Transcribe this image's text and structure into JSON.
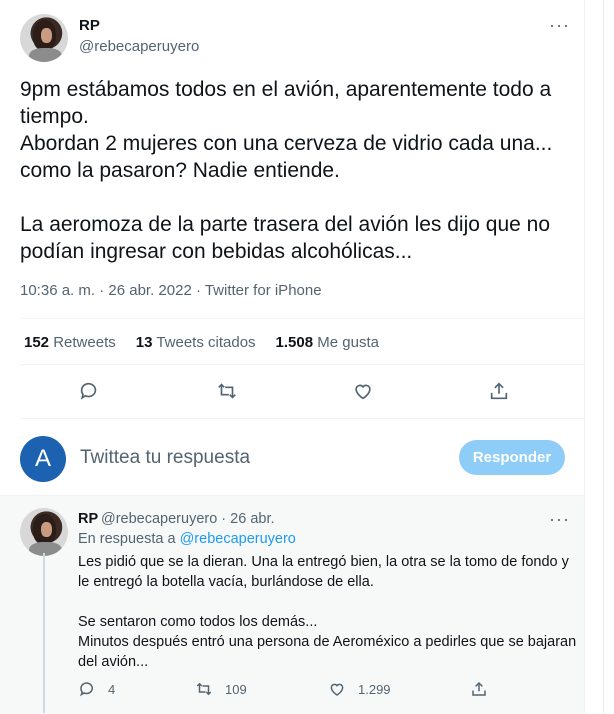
{
  "tweet": {
    "name": "RP",
    "handle": "@rebecaperuyero",
    "more": "···",
    "text": "9pm estábamos todos en el avión, aparentemente todo a tiempo.\nAbordan 2 mujeres con una cerveza de vidrio cada una... como la pasaron? Nadie entiende.\n\nLa aeromoza de la parte trasera del avión les dijo que no podían ingresar con bebidas alcohólicas...",
    "meta": "10:36 a. m. · 26 abr. 2022 · Twitter for iPhone",
    "stats": {
      "retweets_count": "152",
      "retweets_label": "Retweets",
      "quotes_count": "13",
      "quotes_label": "Tweets citados",
      "likes_count": "1.508",
      "likes_label": "Me gusta"
    },
    "actions": [
      "reply-icon",
      "retweet-icon",
      "like-icon",
      "share-icon"
    ]
  },
  "composer": {
    "avatar_letter": "A",
    "placeholder": "Twittea tu respuesta",
    "button_label": "Responder",
    "button_color": "#8ecdf8"
  },
  "reply": {
    "name": "RP",
    "handle_date": "@rebecaperuyero · 26 abr.",
    "more": "···",
    "replying_prefix": "En respuesta a",
    "replying_mention": "@rebecaperuyero",
    "text": "Les pidió que se la dieran. Una la entregó bien, la otra se la tomo de fondo y le entregó la botella vacía, burlándose de ella.\n\nSe sentaron como todos los demás...\nMinutos después entró una persona de Aeroméxico a pedirles que se bajaran del avión...",
    "reply_count": "4",
    "retweet_count": "109",
    "like_count": "1.299"
  },
  "colors": {
    "accent": "#1d9bf0",
    "secondary_text": "#536471",
    "reply_bg": "#f7f9f9"
  }
}
